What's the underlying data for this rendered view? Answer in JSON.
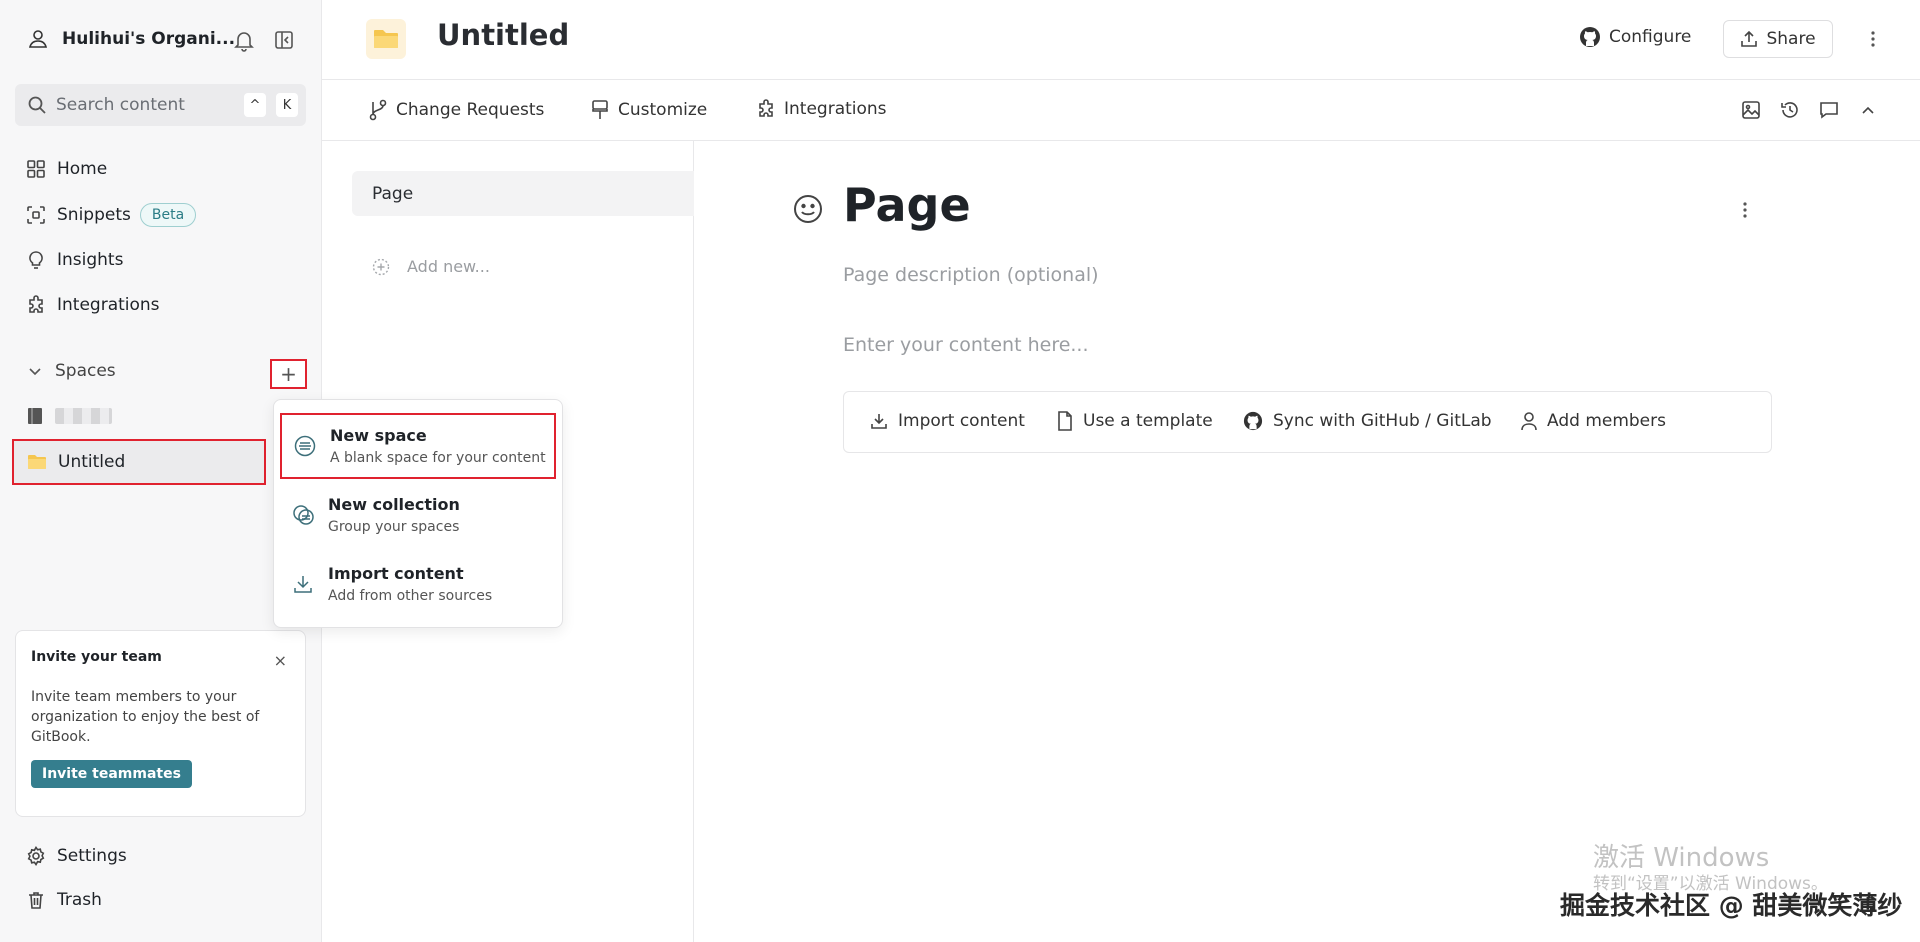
{
  "sidebar": {
    "org_name": "Hulihui's Organi...",
    "search_placeholder": "Search content",
    "shortcut_keys": [
      "^",
      "K"
    ],
    "nav": [
      {
        "label": "Home",
        "icon": "grid-icon"
      },
      {
        "label": "Snippets",
        "icon": "snippet-icon",
        "badge": "Beta"
      },
      {
        "label": "Insights",
        "icon": "lightbulb-icon"
      },
      {
        "label": "Integrations",
        "icon": "puzzle-icon"
      }
    ],
    "spaces_label": "Spaces",
    "add_button": "+",
    "spaces": [
      {
        "label": "",
        "icon": "book-icon",
        "blurred": true
      },
      {
        "label": "Untitled",
        "icon": "folder-icon",
        "selected": true
      }
    ],
    "invite": {
      "title": "Invite your team",
      "close": "×",
      "body": "Invite team members to your organization to enjoy the best of GitBook.",
      "button": "Invite teammates"
    },
    "footer": [
      {
        "label": "Settings",
        "icon": "gear-icon"
      },
      {
        "label": "Trash",
        "icon": "trash-icon"
      }
    ]
  },
  "header": {
    "title": "Untitled",
    "configure": "Configure",
    "share": "Share"
  },
  "toolbar": {
    "change_requests": "Change Requests",
    "customize": "Customize",
    "integrations": "Integrations"
  },
  "tree": {
    "page": "Page",
    "add_new": "Add new..."
  },
  "editor": {
    "title": "Page",
    "description_placeholder": "Page description (optional)",
    "content_placeholder": "Enter your content here...",
    "actions": [
      "Import content",
      "Use a template",
      "Sync with GitHub / GitLab",
      "Add members"
    ]
  },
  "dropdown": {
    "items": [
      {
        "title": "New space",
        "subtitle": "A blank space for your content",
        "icon": "space-icon"
      },
      {
        "title": "New collection",
        "subtitle": "Group your spaces",
        "icon": "collection-icon"
      },
      {
        "title": "Import content",
        "subtitle": "Add from other sources",
        "icon": "download-icon"
      }
    ]
  },
  "watermark": {
    "activate_title": "激活 Windows",
    "activate_sub": "转到“设置”以激活 Windows。",
    "credit": "掘金技术社区 @ 甜美微笑薄纱"
  },
  "colors": {
    "accent": "#357e8e",
    "highlight": "#e0222f",
    "sidebar_bg": "#f7f7f8"
  }
}
